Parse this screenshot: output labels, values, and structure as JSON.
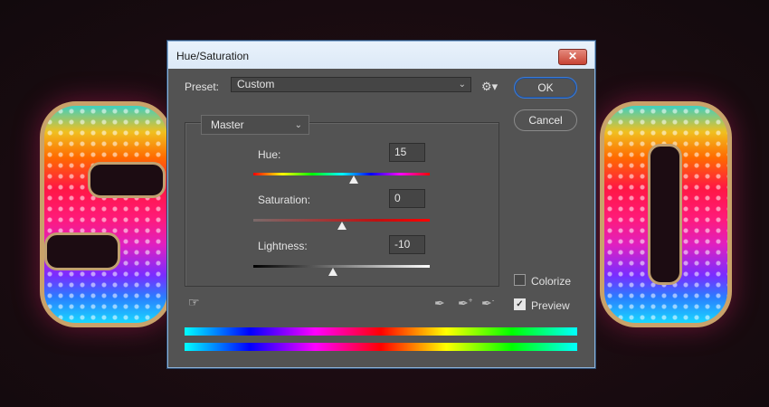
{
  "dialog": {
    "title": "Hue/Saturation",
    "close_symbol": "✕",
    "preset_label": "Preset:",
    "preset_value": "Custom",
    "ok_label": "OK",
    "cancel_label": "Cancel",
    "channel_value": "Master",
    "hue_label": "Hue:",
    "hue_value": "15",
    "saturation_label": "Saturation:",
    "saturation_value": "0",
    "lightness_label": "Lightness:",
    "lightness_value": "-10",
    "colorize_label": "Colorize",
    "colorize_checked": false,
    "preview_label": "Preview",
    "preview_checked": true,
    "hue_slider_position": 0.57,
    "saturation_slider_position": 0.5,
    "lightness_slider_position": 0.45
  },
  "icons": {
    "gear": "gear-icon",
    "on_image_adjust": "hand-target-icon",
    "eyedropper": "eyedropper-icon",
    "eyedropper_add": "eyedropper-plus-icon",
    "eyedropper_subtract": "eyedropper-minus-icon"
  },
  "colors": {
    "dialog_bg": "#535353",
    "titlebar_bg": "#dce9f7",
    "ok_border": "#3b7bd6",
    "close_button": "#c84434"
  }
}
